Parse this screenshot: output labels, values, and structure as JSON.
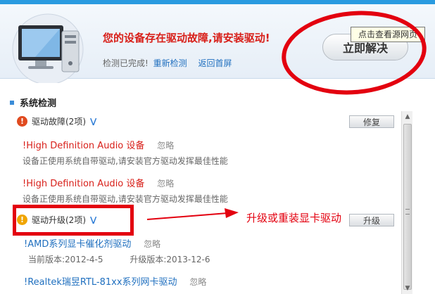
{
  "header": {
    "alert_title": "您的设备存在驱动故障,请安装驱动!",
    "status_prefix": "检测已完成!",
    "recheck_link": "重新检测",
    "home_link": "返回首屏",
    "fix_button": "立即解决",
    "tooltip": "点击查看源网页"
  },
  "section": {
    "title": "系统检测"
  },
  "categories": [
    {
      "label": "驱动故障(2项)",
      "button": "修复",
      "icon": "error-icon"
    },
    {
      "label": "驱动升级(2项)",
      "button": "升级",
      "icon": "warning-icon"
    }
  ],
  "fault_items": [
    {
      "name": "!High Definition Audio 设备",
      "ignore": "忽略",
      "desc": "设备正使用系统自带驱动,请安装官方驱动发挥最佳性能"
    },
    {
      "name": "!High Definition Audio 设备",
      "ignore": "忽略",
      "desc": "设备正使用系统自带驱动,请安装官方驱动发挥最佳性能"
    }
  ],
  "upgrade_items": [
    {
      "name": "!AMD系列显卡催化剂驱动",
      "ignore": "忽略",
      "current": "当前版本:2012-4-5",
      "upgrade": "升级版本:2013-12-6"
    },
    {
      "name": "!Realtek瑞昱RTL-81xx系列网卡驱动",
      "ignore": "忽略"
    }
  ],
  "annotation": "升级或重装显卡驱动",
  "colors": {
    "accent": "#2a9be0",
    "alert": "#d8201a",
    "link": "#1f6fbf",
    "markup": "#e3000f"
  }
}
